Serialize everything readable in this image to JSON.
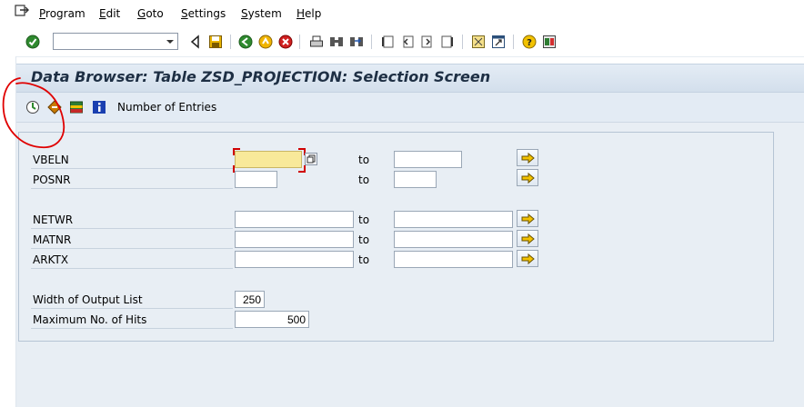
{
  "menu": {
    "program": "Program",
    "edit": "Edit",
    "goto": "Goto",
    "settings": "Settings",
    "system": "System",
    "help": "Help"
  },
  "standard_toolbar": {
    "command_field": {
      "value": "",
      "placeholder": ""
    },
    "icons": [
      "enter-icon",
      "back-icon",
      "save-icon",
      "back-green-icon",
      "exit-icon",
      "cancel-icon",
      "print-icon",
      "find-icon",
      "find-next-icon",
      "first-page-icon",
      "previous-page-icon",
      "next-page-icon",
      "last-page-icon",
      "create-session-icon",
      "shortcut-icon",
      "help-icon",
      "customize-layout-icon"
    ]
  },
  "title": "Data Browser: Table ZSD_PROJECTION: Selection Screen",
  "app_toolbar": {
    "number_of_entries": "Number of Entries",
    "icons": [
      "execute-icon",
      "get-variant-icon",
      "save-variant-icon",
      "info-icon"
    ]
  },
  "selection": {
    "to_label": "to",
    "rows": [
      {
        "label": "VBELN",
        "low": "",
        "high": ""
      },
      {
        "label": "POSNR",
        "low": "",
        "high": ""
      },
      {
        "label": "NETWR",
        "low": "",
        "high": ""
      },
      {
        "label": "MATNR",
        "low": "",
        "high": ""
      },
      {
        "label": "ARKTX",
        "low": "",
        "high": ""
      }
    ],
    "width_of_output_list": {
      "label": "Width of Output List",
      "value": "250"
    },
    "maximum_hits": {
      "label": "Maximum No. of Hits",
      "value": "500"
    }
  },
  "colors": {
    "required_field": "#f8e99a",
    "annotation": "#e00000",
    "title_text": "#1e2f44",
    "body_bg": "#e8eef4"
  }
}
